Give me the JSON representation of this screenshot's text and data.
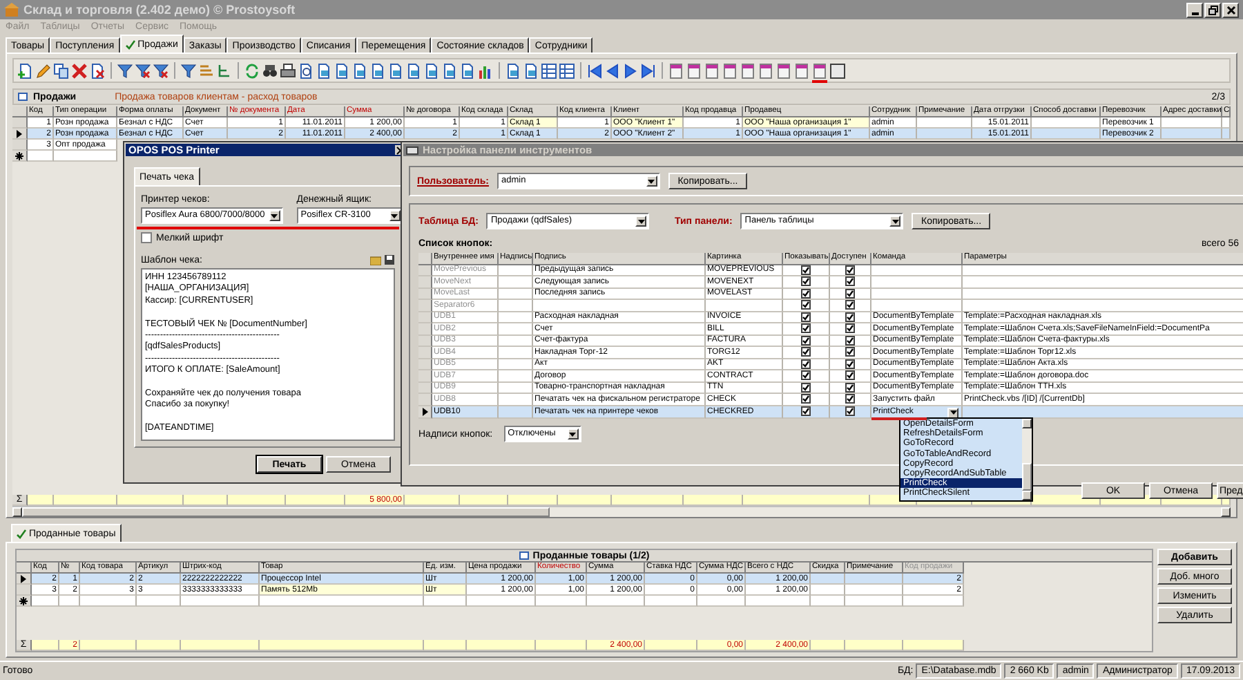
{
  "window": {
    "title": "Склад и торговля (2.402 демо) © Prostoysoft"
  },
  "menu": [
    "Файл",
    "Таблицы",
    "Отчеты",
    "Сервис",
    "Помощь"
  ],
  "tabs": [
    {
      "label": "Товары",
      "selected": false
    },
    {
      "label": "Поступления",
      "selected": false
    },
    {
      "label": "Продажи",
      "selected": true
    },
    {
      "label": "Заказы",
      "selected": false
    },
    {
      "label": "Производство",
      "selected": false
    },
    {
      "label": "Списания",
      "selected": false
    },
    {
      "label": "Перемещения",
      "selected": false
    },
    {
      "label": "Состояние складов",
      "selected": false
    },
    {
      "label": "Сотрудники",
      "selected": false
    }
  ],
  "toolbar": [
    {
      "kind": "doc-add"
    },
    {
      "kind": "pencil"
    },
    {
      "kind": "copy"
    },
    {
      "kind": "cross"
    },
    {
      "kind": "doc-cross"
    },
    {
      "kind": "sep"
    },
    {
      "kind": "filter"
    },
    {
      "kind": "filter-x"
    },
    {
      "kind": "filter-x"
    },
    {
      "kind": "sep"
    },
    {
      "kind": "filter"
    },
    {
      "kind": "sort"
    },
    {
      "kind": "tree"
    },
    {
      "kind": "sep"
    },
    {
      "kind": "refresh"
    },
    {
      "kind": "binoculars"
    },
    {
      "kind": "printer"
    },
    {
      "kind": "preview"
    },
    {
      "kind": "doc"
    },
    {
      "kind": "doc"
    },
    {
      "kind": "doc"
    },
    {
      "kind": "doc"
    },
    {
      "kind": "doc"
    },
    {
      "kind": "doc"
    },
    {
      "kind": "doc"
    },
    {
      "kind": "doc"
    },
    {
      "kind": "doc"
    },
    {
      "kind": "chart"
    },
    {
      "kind": "sep"
    },
    {
      "kind": "doc"
    },
    {
      "kind": "doc"
    },
    {
      "kind": "grid"
    },
    {
      "kind": "grid"
    },
    {
      "kind": "sep"
    },
    {
      "kind": "first"
    },
    {
      "kind": "prev"
    },
    {
      "kind": "next"
    },
    {
      "kind": "last"
    },
    {
      "kind": "sep"
    },
    {
      "kind": "report"
    },
    {
      "kind": "report"
    },
    {
      "kind": "report"
    },
    {
      "kind": "report"
    },
    {
      "kind": "report"
    },
    {
      "kind": "report"
    },
    {
      "kind": "report"
    },
    {
      "kind": "report"
    },
    {
      "kind": "report",
      "marked": true
    },
    {
      "kind": "box"
    }
  ],
  "sales": {
    "sum_symbol": "Σ",
    "title": "Продажи",
    "subtitle": "Продажа товаров клиентам - расход товаров",
    "counter": "2/3",
    "columns": [
      {
        "label": "Код"
      },
      {
        "label": "Тип операции"
      },
      {
        "label": "Форма оплаты"
      },
      {
        "label": "Документ"
      },
      {
        "label": "№ документа",
        "color": "#c00000"
      },
      {
        "label": "Дата",
        "color": "#c00000"
      },
      {
        "label": "Сумма",
        "color": "#c00000",
        "total": "5 800,00"
      },
      {
        "label": "№ договора"
      },
      {
        "label": "Код склада"
      },
      {
        "label": "Склад",
        "lookup": true
      },
      {
        "label": "Код клиента"
      },
      {
        "label": "Клиент",
        "lookup": true
      },
      {
        "label": "Код продавца"
      },
      {
        "label": "Продавец",
        "lookup": true
      },
      {
        "label": "Сотрудник"
      },
      {
        "label": "Примечание"
      },
      {
        "label": "Дата отгрузки"
      },
      {
        "label": "Способ доставки"
      },
      {
        "label": "Перевозчик"
      },
      {
        "label": "Адрес доставки"
      },
      {
        "label": "С"
      }
    ],
    "rows": [
      {
        "kind": "record",
        "selected": false,
        "cells": [
          "1",
          "Розн продажа",
          "Безнал с НДС",
          "Счет",
          "1",
          "11.01.2011",
          "1 200,00",
          "1",
          "1",
          "Склад 1",
          "1",
          "ООО \"Клиент 1\"",
          "1",
          "ООО \"Наша организация 1\"",
          "admin",
          null,
          "15.01.2011",
          null,
          "Перевозчик 1",
          null,
          null
        ]
      },
      {
        "kind": "record",
        "selected": true,
        "cells": [
          "2",
          "Розн продажа",
          "Безнал с НДС",
          "Счет",
          "2",
          "11.01.2011",
          "2 400,00",
          "2",
          "1",
          "Склад 1",
          "2",
          "ООО \"Клиент 2\"",
          "1",
          "ООО \"Наша организация 1\"",
          "admin",
          null,
          "15.01.2011",
          null,
          "Перевозчик 2",
          null,
          null
        ]
      },
      {
        "kind": "record",
        "selected": false,
        "cells": [
          "3",
          "Опт продажа"
        ]
      },
      {
        "kind": "new",
        "selected": false,
        "cells": [
          null,
          null
        ]
      }
    ]
  },
  "details": {
    "sum_symbol": "Σ",
    "tab": "Проданные товары",
    "title": "Проданные товары (1/2)",
    "columns": [
      {
        "label": "Код"
      },
      {
        "label": "№",
        "total": "2"
      },
      {
        "label": "Код товара"
      },
      {
        "label": "Артикул"
      },
      {
        "label": "Штрих-код"
      },
      {
        "label": "Товар",
        "lookup": true
      },
      {
        "label": "Ед. изм.",
        "lookup": true
      },
      {
        "label": "Цена продажи"
      },
      {
        "label": "Количество",
        "color": "#c00000"
      },
      {
        "label": "Сумма",
        "total": "2 400,00"
      },
      {
        "label": "Ставка НДС"
      },
      {
        "label": "Сумма НДС",
        "total": "0,00"
      },
      {
        "label": "Всего с НДС",
        "total": "2 400,00"
      },
      {
        "label": "Скидка"
      },
      {
        "label": "Примечание"
      },
      {
        "label": "Код продажи",
        "color": "#909090"
      }
    ],
    "rows": [
      {
        "kind": "record",
        "selected": true,
        "cells": [
          "2",
          "1",
          "2",
          "2",
          "2222222222222",
          "Процессор Intel",
          "Шт",
          "1 200,00",
          "1,00",
          "1 200,00",
          "0",
          "0,00",
          "1 200,00",
          null,
          null,
          "2"
        ]
      },
      {
        "kind": "record",
        "selected": false,
        "cells": [
          "3",
          "2",
          "3",
          "3",
          "3333333333333",
          "Память 512Mb",
          "Шт",
          "1 200,00",
          "1,00",
          "1 200,00",
          "0",
          "0,00",
          "1 200,00",
          null,
          null,
          "2"
        ]
      },
      {
        "kind": "new",
        "selected": false,
        "cells": [
          null,
          null,
          null,
          null,
          null,
          null,
          null,
          null,
          null,
          null,
          null,
          null,
          null,
          null,
          null,
          null
        ]
      }
    ],
    "buttons": [
      "Добавить",
      "Доб. много",
      "Изменить",
      "Удалить"
    ]
  },
  "pos_printer": {
    "title": "OPOS POS Printer",
    "tab": "Печать чека",
    "printer_label": "Принтер чеков:",
    "printer": "Posiflex Aura 6800/7000/8000",
    "drawer_label": "Денежный ящик:",
    "drawer": "Posiflex CR-3100",
    "devices_marked": true,
    "small_font": {
      "label": "Мелкий шрифт",
      "checked": false
    },
    "template_label": "Шаблон чека:",
    "template": "ИНН 123456789112\n[НАША_ОРГАНИЗАЦИЯ]\nКассир: [CURRENTUSER]\n\nТЕСТОВЫЙ ЧЕК № [DocumentNumber]\n---------------------------------------------\n[qdfSalesProducts]\n---------------------------------------------\nИТОГО К ОПЛАТЕ: [SaleAmount]\n\nСохраняйте чек до получения товара\nСпасибо за покупку!\n\n[DATEANDTIME]",
    "buttons": [
      "Печать",
      "Отмена"
    ]
  },
  "toolbar_settings": {
    "title": "Настройка панели инструментов",
    "user_label": "Пользователь:",
    "user": "admin",
    "copy1": "Копировать...",
    "table_label": "Таблица БД:",
    "table": "Продажи (qdfSales)",
    "panel_label": "Тип панели:",
    "panel": "Панель таблицы",
    "copy2": "Копировать...",
    "list_label": "Список кнопок:",
    "total": "всего 56",
    "columns": [
      "Внутреннее имя",
      "Надпись",
      "Подпись",
      "Картинка",
      "Показывать",
      "Доступен",
      "Команда",
      "Параметры"
    ],
    "rows": [
      {
        "name": "MovePrevious",
        "label": "Предыдущая запись",
        "picture": "MOVEPREVIOUS",
        "show": true,
        "enabled": true,
        "command": null,
        "params": null,
        "selected": false
      },
      {
        "name": "MoveNext",
        "label": "Следующая запись",
        "picture": "MOVENEXT",
        "show": true,
        "enabled": true,
        "command": null,
        "params": null,
        "selected": false
      },
      {
        "name": "MoveLast",
        "label": "Последняя запись",
        "picture": "MOVELAST",
        "show": true,
        "enabled": true,
        "command": null,
        "params": null,
        "selected": false
      },
      {
        "name": "Separator6",
        "label": null,
        "picture": null,
        "show": true,
        "enabled": true,
        "command": null,
        "params": null,
        "selected": false
      },
      {
        "name": "UDB1",
        "label": "Расходная накладная",
        "picture": "INVOICE",
        "show": true,
        "enabled": true,
        "command": "DocumentByTemplate",
        "params": "Template:=Расходная накладная.xls",
        "selected": false
      },
      {
        "name": "UDB2",
        "label": "Счет",
        "picture": "BILL",
        "show": true,
        "enabled": true,
        "command": "DocumentByTemplate",
        "params": "Template:=Шаблон Счета.xls;SaveFileNameInField:=DocumentPa",
        "selected": false
      },
      {
        "name": "UDB3",
        "label": "Счет-фактура",
        "picture": "FACTURA",
        "show": true,
        "enabled": true,
        "command": "DocumentByTemplate",
        "params": "Template:=Шаблон Счета-фактуры.xls",
        "selected": false
      },
      {
        "name": "UDB4",
        "label": "Накладная Торг-12",
        "picture": "TORG12",
        "show": true,
        "enabled": true,
        "command": "DocumentByTemplate",
        "params": "Template:=Шаблон Торг12.xls",
        "selected": false
      },
      {
        "name": "UDB5",
        "label": "Акт",
        "picture": "AKT",
        "show": true,
        "enabled": true,
        "command": "DocumentByTemplate",
        "params": "Template:=Шаблон Акта.xls",
        "selected": false
      },
      {
        "name": "UDB7",
        "label": "Договор",
        "picture": "CONTRACT",
        "show": true,
        "enabled": true,
        "command": "DocumentByTemplate",
        "params": "Template:=Шаблон договора.doc",
        "selected": false
      },
      {
        "name": "UDB9",
        "label": "Товарно-транспортная накладная",
        "picture": "TTN",
        "show": true,
        "enabled": true,
        "command": "DocumentByTemplate",
        "params": "Template:=Шаблон ТТН.xls",
        "selected": false
      },
      {
        "name": "UDB8",
        "label": "Печатать чек на фискальном регистраторе",
        "picture": "CHECK",
        "show": true,
        "enabled": true,
        "command": "Запустить файл",
        "params": "PrintCheck.vbs /[ID] /[CurrentDb]",
        "selected": false
      },
      {
        "name": "UDB10",
        "label": "Печатать чек на принтере чеков",
        "picture": "CHECKRED",
        "show": true,
        "enabled": true,
        "command": "PrintCheck",
        "params": null,
        "selected": true,
        "command_marked": true
      }
    ],
    "command_options": [
      {
        "label": "OpenDetailsForm",
        "selected": false
      },
      {
        "label": "RefreshDetailsForm",
        "selected": false
      },
      {
        "label": "GoToRecord",
        "selected": false
      },
      {
        "label": "GoToTableAndRecord",
        "selected": false
      },
      {
        "label": "CopyRecord",
        "selected": false
      },
      {
        "label": "CopyRecordAndSubTable",
        "selected": false
      },
      {
        "label": "PrintCheck",
        "selected": true
      },
      {
        "label": "PrintCheckSilent",
        "selected": false
      }
    ],
    "captions_label": "Надписи кнопок:",
    "captions": "Отключены",
    "buttons": [
      "OK",
      "Отмена",
      "Пред"
    ]
  },
  "status_bar": {
    "text": "Готово",
    "db_label": "БД:",
    "fields": [
      "E:\\Database.mdb",
      "2 660 Kb",
      "admin",
      "Администратор",
      "17.09.2013"
    ]
  }
}
